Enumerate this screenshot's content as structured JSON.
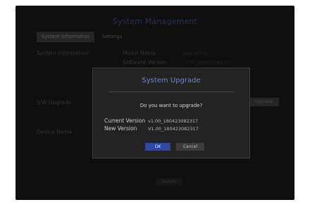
{
  "window": {
    "title": "System Management",
    "tabs": [
      {
        "label": "System Information",
        "active": true
      },
      {
        "label": "Settings",
        "active": false
      }
    ],
    "footer_button": "Return"
  },
  "background": {
    "system_information_label": "System Information",
    "model_name_label": "Model Name",
    "model_name_value": "SRN-1670D",
    "software_version_label": "Software Version",
    "software_version_value": "v1.00_180423082317",
    "sw_upgrade_label": "S/W Upgrade",
    "upgrade_button": "Upgrade",
    "device_name_label": "Device Name"
  },
  "dialog": {
    "title": "System Upgrade",
    "question": "Do you want to upgrade?",
    "current_version_label": "Current Version",
    "current_version_value": "v1.00_180423082317",
    "new_version_label": "New Version",
    "new_version_value": "V1.00_180423082317",
    "ok_label": "OK",
    "cancel_label": "Cancel"
  },
  "colors": {
    "background": "#181818",
    "dialog_bg": "#232323",
    "title_accent": "#6f86d0",
    "ok_button": "#2e48a8"
  }
}
